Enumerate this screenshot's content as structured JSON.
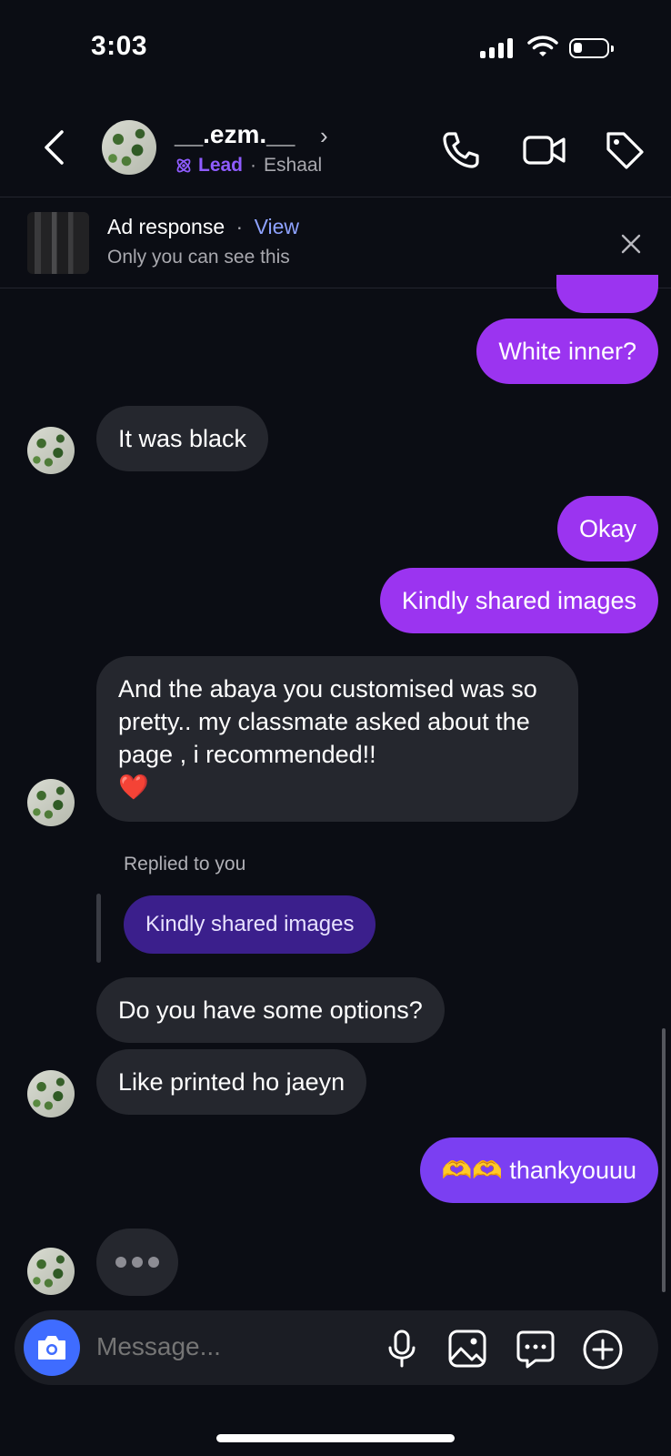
{
  "status_bar": {
    "time": "3:03"
  },
  "header": {
    "username": "__.ezm.__",
    "lead_label": "Lead",
    "separator": "·",
    "assignee": "Eshaal"
  },
  "ad_banner": {
    "title": "Ad response",
    "separator": "·",
    "view_label": "View",
    "subtitle": "Only you can see this"
  },
  "messages": [
    {
      "from": "me",
      "text": "White inner?"
    },
    {
      "from": "them",
      "text": "It was black"
    },
    {
      "from": "me",
      "text": "Okay"
    },
    {
      "from": "me",
      "text": "Kindly shared images"
    },
    {
      "from": "them",
      "text": "And the abaya you customised was so pretty.. my classmate asked about the page , i recommended!!",
      "emoji": "❤️"
    },
    {
      "from": "them",
      "text": "Do you have some options?"
    },
    {
      "from": "them",
      "text": "Like printed ho jaeyn"
    },
    {
      "from": "me",
      "text": "thankyouuu",
      "emoji": "🫶🫶"
    }
  ],
  "reply": {
    "label": "Replied to you",
    "quoted_text": "Kindly shared images"
  },
  "composer": {
    "placeholder": "Message..."
  },
  "colors": {
    "background": "#0b0d14",
    "outgoing_bubble": "#9b34f0",
    "outgoing_bubble_last": "#7b3ff2",
    "incoming_bubble": "#25272e",
    "lead_accent": "#8f5cff",
    "link_blue": "#8ea2ff",
    "camera_button": "#3f6cff"
  }
}
